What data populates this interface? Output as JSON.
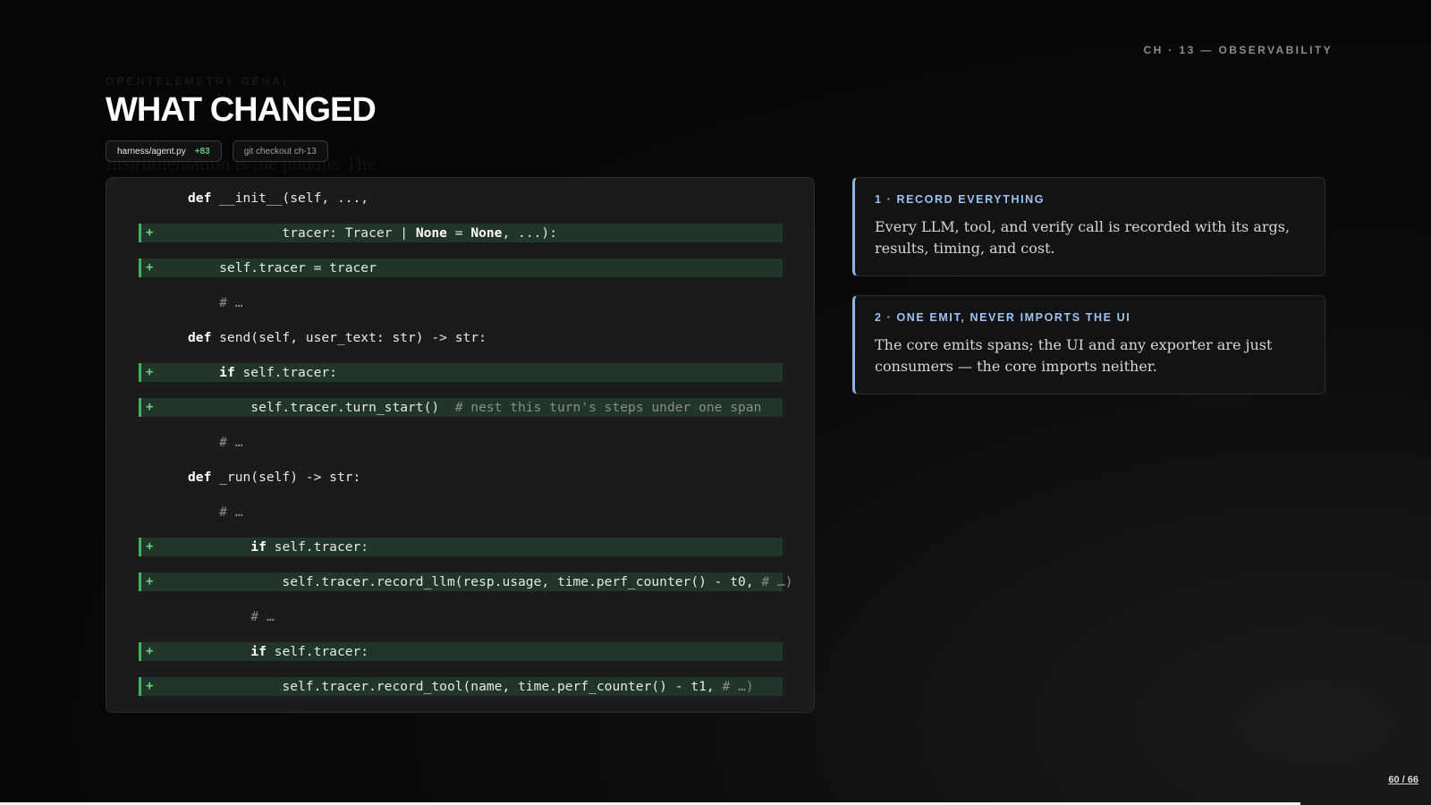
{
  "header": {
    "chapter": "CH · 13 — OBSERVABILITY",
    "ghost_eyebrow": "OPENTELEMETRY GENAI",
    "ghost_line": "Instrumentation is the puddle. The",
    "title": "WHAT CHANGED"
  },
  "chips": {
    "file": "harness/agent.py",
    "additions": "+83",
    "git": "git checkout ch-13"
  },
  "code": {
    "lines": [
      {
        "added": false,
        "parts": [
          {
            "t": "def",
            "c": "kw"
          },
          {
            "t": " __init__(self, ...,"
          }
        ]
      },
      {
        "added": true,
        "parts": [
          {
            "t": "            tracer: Tracer | "
          },
          {
            "t": "None",
            "c": "kw"
          },
          {
            "t": " = "
          },
          {
            "t": "None",
            "c": "kw"
          },
          {
            "t": ", ...):"
          }
        ]
      },
      {
        "added": true,
        "parts": [
          {
            "t": "    self.tracer = tracer"
          }
        ]
      },
      {
        "added": false,
        "parts": [
          {
            "t": "    # …",
            "c": "cm"
          }
        ]
      },
      {
        "added": false,
        "parts": [
          {
            "t": "def",
            "c": "kw"
          },
          {
            "t": " send(self, user_text: str) -> str:"
          }
        ]
      },
      {
        "added": true,
        "parts": [
          {
            "t": "    "
          },
          {
            "t": "if",
            "c": "kw"
          },
          {
            "t": " self.tracer:"
          }
        ]
      },
      {
        "added": true,
        "parts": [
          {
            "t": "        self.tracer.turn_start()  "
          },
          {
            "t": "# nest this turn's steps under one span",
            "c": "cm"
          }
        ]
      },
      {
        "added": false,
        "parts": [
          {
            "t": "    # …",
            "c": "cm"
          }
        ]
      },
      {
        "added": false,
        "parts": [
          {
            "t": "def",
            "c": "kw"
          },
          {
            "t": " _run(self) -> str:"
          }
        ]
      },
      {
        "added": false,
        "parts": [
          {
            "t": "    # …",
            "c": "cm"
          }
        ]
      },
      {
        "added": true,
        "parts": [
          {
            "t": "        "
          },
          {
            "t": "if",
            "c": "kw"
          },
          {
            "t": " self.tracer:"
          }
        ]
      },
      {
        "added": true,
        "parts": [
          {
            "t": "            self.tracer.record_llm(resp.usage, time.perf_counter() - t0, "
          },
          {
            "t": "# …)",
            "c": "cm"
          }
        ]
      },
      {
        "added": false,
        "parts": [
          {
            "t": "        # …",
            "c": "cm"
          }
        ]
      },
      {
        "added": true,
        "parts": [
          {
            "t": "        "
          },
          {
            "t": "if",
            "c": "kw"
          },
          {
            "t": " self.tracer:"
          }
        ]
      },
      {
        "added": true,
        "parts": [
          {
            "t": "            self.tracer.record_tool(name, time.perf_counter() - t1, "
          },
          {
            "t": "# …)",
            "c": "cm"
          }
        ]
      }
    ],
    "added_marker": "+"
  },
  "cards": [
    {
      "title": "1 · RECORD EVERYTHING",
      "body": "Every LLM, tool, and verify call is recorded with its args, results, timing, and cost."
    },
    {
      "title": "2 · ONE EMIT, NEVER IMPORTS THE UI",
      "body": "The core emits spans; the UI and any exporter are just consumers — the core imports neither."
    }
  ],
  "footer": {
    "pager": "60 / 66",
    "progress": 0.909
  }
}
